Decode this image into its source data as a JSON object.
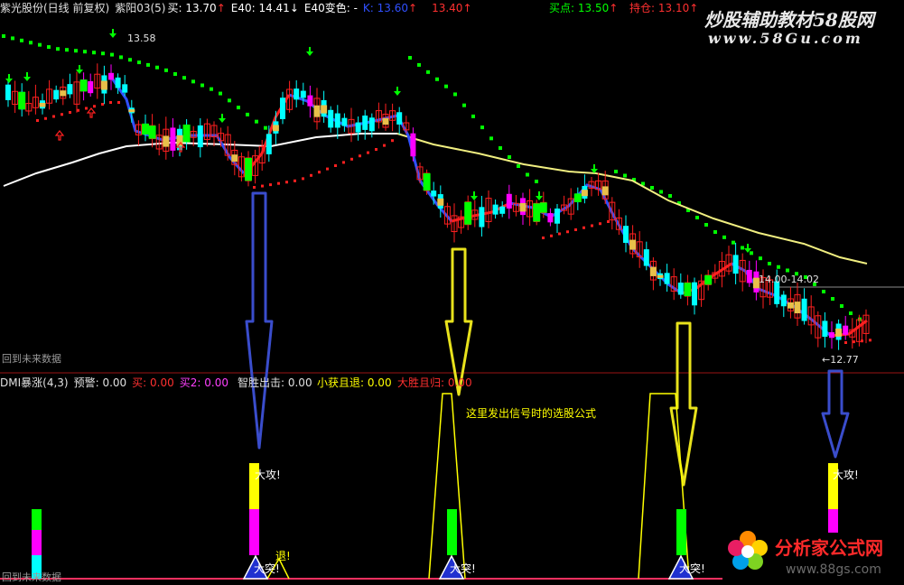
{
  "header": {
    "stock": "紫光股份(日线 前复权)",
    "indicator": "紫阳03(5)",
    "buy_label": "买: 13.70",
    "buy_arrow": "↑",
    "e40_label": "E40: 14.41",
    "e40_arrow": "↓",
    "e40_color_label": "E40变色: -",
    "k_label": "K: 13.60",
    "k_arrow": "↑",
    "v4_label": "13.40",
    "v4_arrow": "↑",
    "buy_point_label": "买点: 13.50",
    "buy_point_arrow": "↑",
    "hold_label": "持仓: 13.10",
    "hold_arrow": "↑"
  },
  "watermark_top": {
    "title": "炒股辅助教材58股网",
    "url": "www.58Gu.com"
  },
  "price_labels": {
    "high": "13.58",
    "mid": "14.00-14.02",
    "low": "12.77"
  },
  "upper_note": "回到未来数据",
  "lower_header": {
    "name": "DMI暴涨(4,3)",
    "warn": "预警: 0.00",
    "buy": "买: 0.00",
    "buy2": "买2: 0.00",
    "strike": "智胜出击: 0.00",
    "small": "小获且退: 0.00",
    "big": "大胜且归: 0.00"
  },
  "annotation": "这里发出信号时的选股公式",
  "signals": {
    "attack": "大攻!",
    "retreat": "退!",
    "wait": "大突!"
  },
  "lower_note": "回到未来数据",
  "watermark_bottom": {
    "title": "分析家公式网",
    "url": "www.88gs.com"
  },
  "colors": {
    "up": "#ff3333",
    "down": "#00ffff",
    "magenta": "#ff00ff",
    "yellow": "#ffff00",
    "green": "#00ff00",
    "white": "#ffffff",
    "blue": "#3050ff",
    "red": "#ff2020",
    "gold": "#e8c04a"
  }
}
